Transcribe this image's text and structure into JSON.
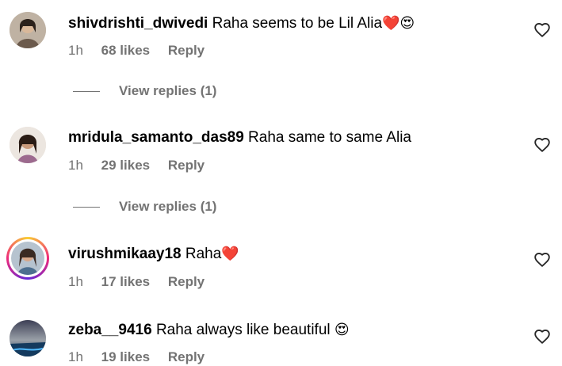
{
  "comments": [
    {
      "username": "shivdrishti_dwivedi",
      "text": "Raha seems to be Lil Alia",
      "emoji": "❤️😍",
      "time": "1h",
      "likes": "68 likes",
      "reply": "Reply",
      "view_replies": "View replies (1)"
    },
    {
      "username": "mridula_samanto_das89",
      "text": "Raha same to same Alia",
      "emoji": "",
      "time": "1h",
      "likes": "29 likes",
      "reply": "Reply",
      "view_replies": "View replies (1)"
    },
    {
      "username": "virushmikaay18",
      "text": "Raha",
      "emoji": "❤️",
      "time": "1h",
      "likes": "17 likes",
      "reply": "Reply"
    },
    {
      "username": "zeba__9416",
      "text": "Raha always like beautiful",
      "emoji": "😍",
      "time": "1h",
      "likes": "19 likes",
      "reply": "Reply"
    }
  ],
  "colors": {
    "meta_gray": "#737373",
    "story_ring": [
      "#f9ce34",
      "#ee2a7b",
      "#6228d7"
    ]
  },
  "icons": {
    "like": "heart-outline-icon"
  }
}
